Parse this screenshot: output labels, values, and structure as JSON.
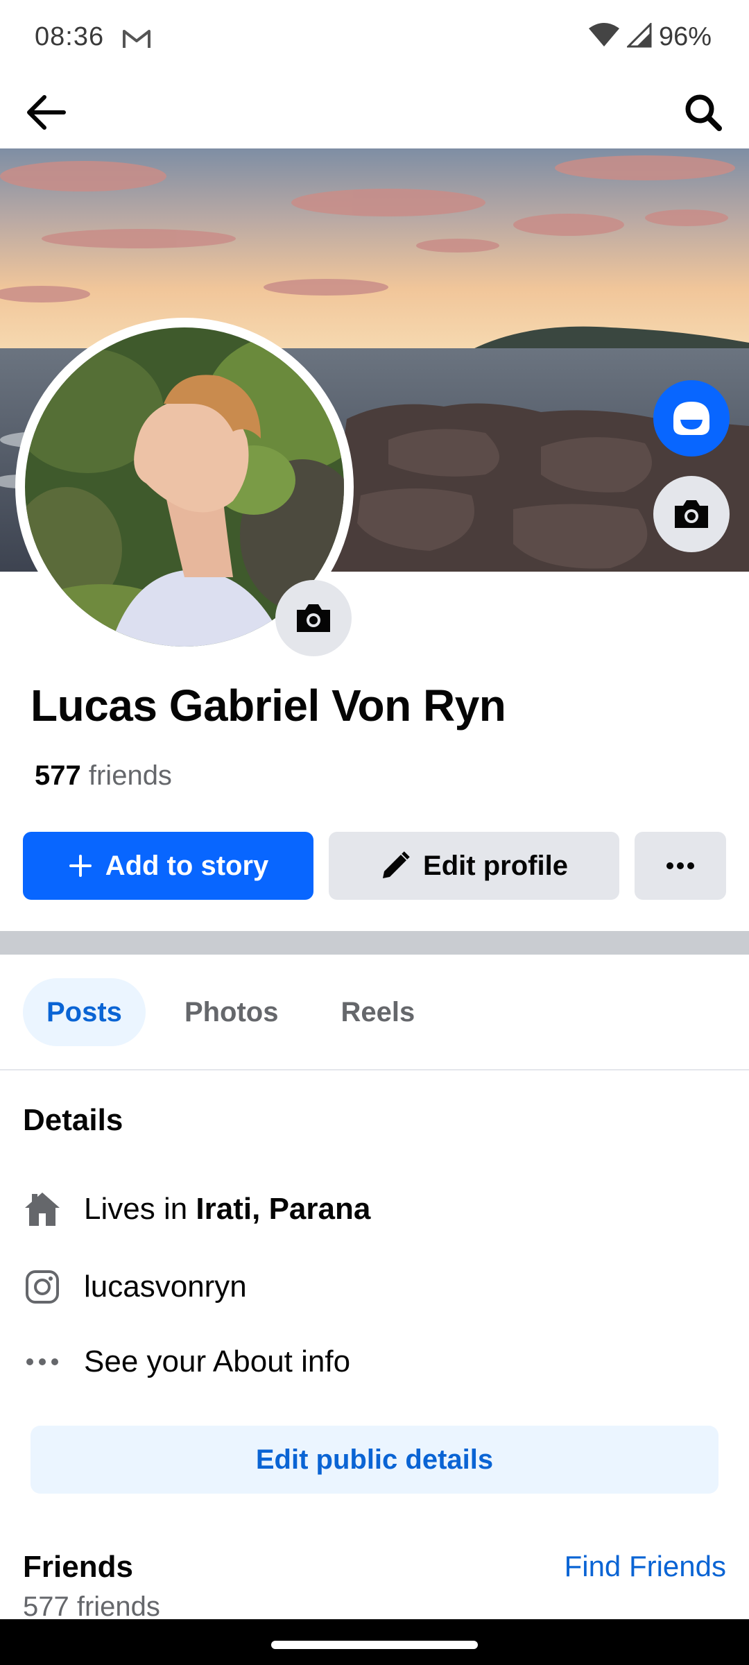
{
  "status_bar": {
    "time": "08:36",
    "battery": "96%",
    "icons": [
      "gmail-icon",
      "wifi-icon",
      "signal-icon"
    ]
  },
  "top_bar": {
    "icons": [
      "back-arrow-icon",
      "search-icon"
    ]
  },
  "profile": {
    "name": "Lucas Gabriel Von Ryn",
    "friends_count": "577",
    "friends_label": "friends"
  },
  "actions": {
    "add_to_story": "Add to story",
    "edit_profile": "Edit profile",
    "more_icon": "more-dots-icon"
  },
  "tabs": [
    {
      "label": "Posts",
      "active": true
    },
    {
      "label": "Photos",
      "active": false
    },
    {
      "label": "Reels",
      "active": false
    }
  ],
  "details": {
    "title": "Details",
    "lives_prefix": "Lives in",
    "lives_place": "Irati, Parana",
    "instagram": "lucasvonryn",
    "about": "See your About info",
    "edit_public": "Edit public details"
  },
  "friends_section": {
    "title": "Friends",
    "find_friends": "Find Friends",
    "count_text": "577 friends"
  },
  "colors": {
    "primary": "#0866ff",
    "link": "#0a64d4",
    "secondary_bg": "#e4e6eb",
    "tab_active_bg": "#ebf5ff",
    "muted_text": "#65676b"
  }
}
